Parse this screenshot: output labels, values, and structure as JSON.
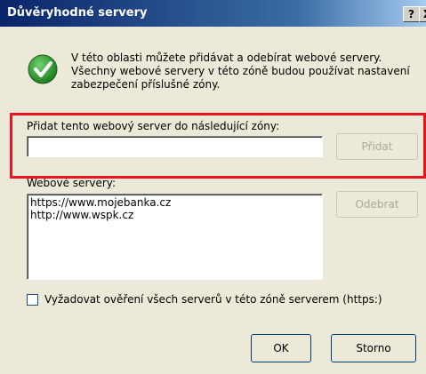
{
  "window": {
    "title": "Důvěryhodné servery",
    "help_button": "?",
    "close_button": "X"
  },
  "intro": {
    "line1": "V této oblasti můžete přidávat a odebírat webové servery.",
    "line2": "Všechny webové servery v této zóně budou používat nastavení",
    "line3": "zabezpečení příslušné zóny."
  },
  "add_section": {
    "label": "Přidat tento webový server do následující zóny:",
    "input_value": "",
    "add_button": "Přidat"
  },
  "servers": {
    "label": "Webové servery:",
    "items": [
      "https://www.mojebanka.cz",
      "http://www.wspk.cz"
    ],
    "remove_button": "Odebrat"
  },
  "require_https": {
    "label": "Vyžadovat ověření všech serverů v této zóně serverem (https:)",
    "checked": false
  },
  "footer": {
    "ok_button": "OK",
    "cancel_button": "Storno"
  },
  "colors": {
    "highlight": "#e8141e",
    "check_green": "#2a9d2a"
  },
  "icons": {
    "info": "check-circle-icon"
  }
}
